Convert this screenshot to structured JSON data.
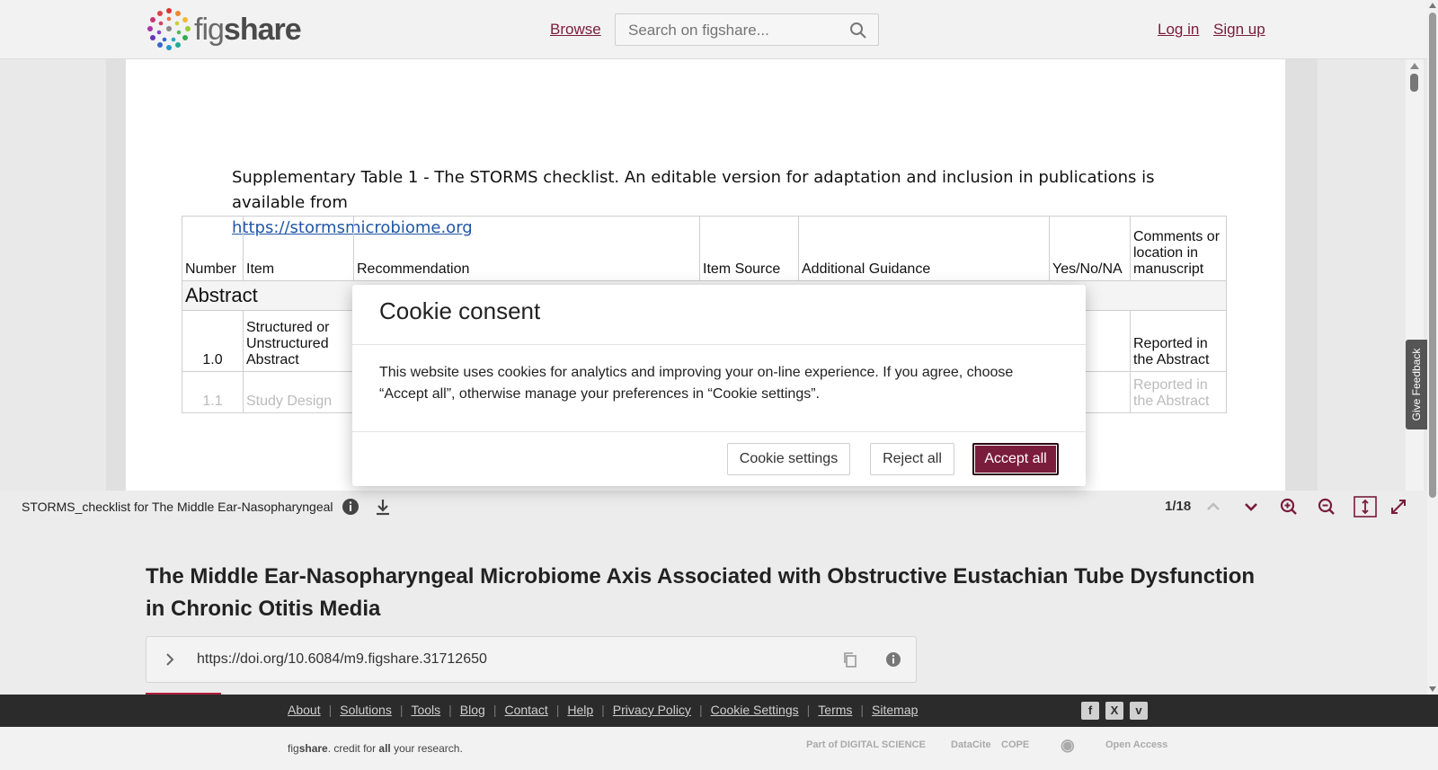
{
  "header": {
    "logo_text_light": "fig",
    "logo_text_bold": "share",
    "browse": "Browse",
    "search_placeholder": "Search on figshare...",
    "login": "Log in",
    "signup": "Sign up"
  },
  "document": {
    "supp_title": "Supplementary Table 1 - The STORMS checklist.  An editable version for adaptation and inclusion in publications is available from",
    "supp_link": "https://stormsmicrobiome.org",
    "columns": [
      "Number",
      "Item",
      "Recommendation",
      "Item Source",
      "Additional Guidance",
      "Yes/No/NA",
      "Comments or location in manuscript"
    ],
    "section": "Abstract",
    "rows": [
      {
        "number": "1.0",
        "item": "Structured or Unstructured Abstract",
        "comment": "Reported in the Abstract"
      },
      {
        "number": "1.1",
        "item": "Study Design",
        "comment": "Reported in the Abstract"
      }
    ]
  },
  "viewer": {
    "file_name": "STORMS_checklist for The Middle Ear-Nasopharyngeal",
    "page_count": "1/18",
    "icons": [
      "info-icon",
      "download-icon",
      "prev-page-icon",
      "next-page-icon",
      "zoom-in-icon",
      "zoom-out-icon",
      "fit-height-icon",
      "fullscreen-icon"
    ]
  },
  "cookie": {
    "title": "Cookie consent",
    "body": "This website uses cookies for analytics and improving your on-line experience. If you agree, choose “Accept all”, otherwise manage your preferences in “Cookie settings”.",
    "settings": "Cookie settings",
    "reject": "Reject all",
    "accept": "Accept all"
  },
  "article": {
    "title": "The Middle Ear-Nasopharyngeal Microbiome Axis Associated with Obstructive Eustachian Tube Dysfunction in Chronic Otitis Media",
    "doi": "https://doi.org/10.6084/m9.figshare.31712650"
  },
  "feedback": "Give Feedback",
  "footer": {
    "links": [
      "About",
      "Solutions",
      "Tools",
      "Blog",
      "Contact",
      "Help",
      "Privacy Policy",
      "Cookie Settings",
      "Terms",
      "Sitemap"
    ],
    "tagline_pre": "fig",
    "tagline_bold": "share",
    "tagline_mid": ". credit for ",
    "tagline_all": "all",
    "tagline_post": " your research.",
    "partners": [
      "Part of DIGITAL SCIENCE",
      "DataCite",
      "COPE",
      "Open Access"
    ]
  },
  "colors": {
    "brand": "#7a1c3b",
    "footer": "#2b2b2b"
  }
}
